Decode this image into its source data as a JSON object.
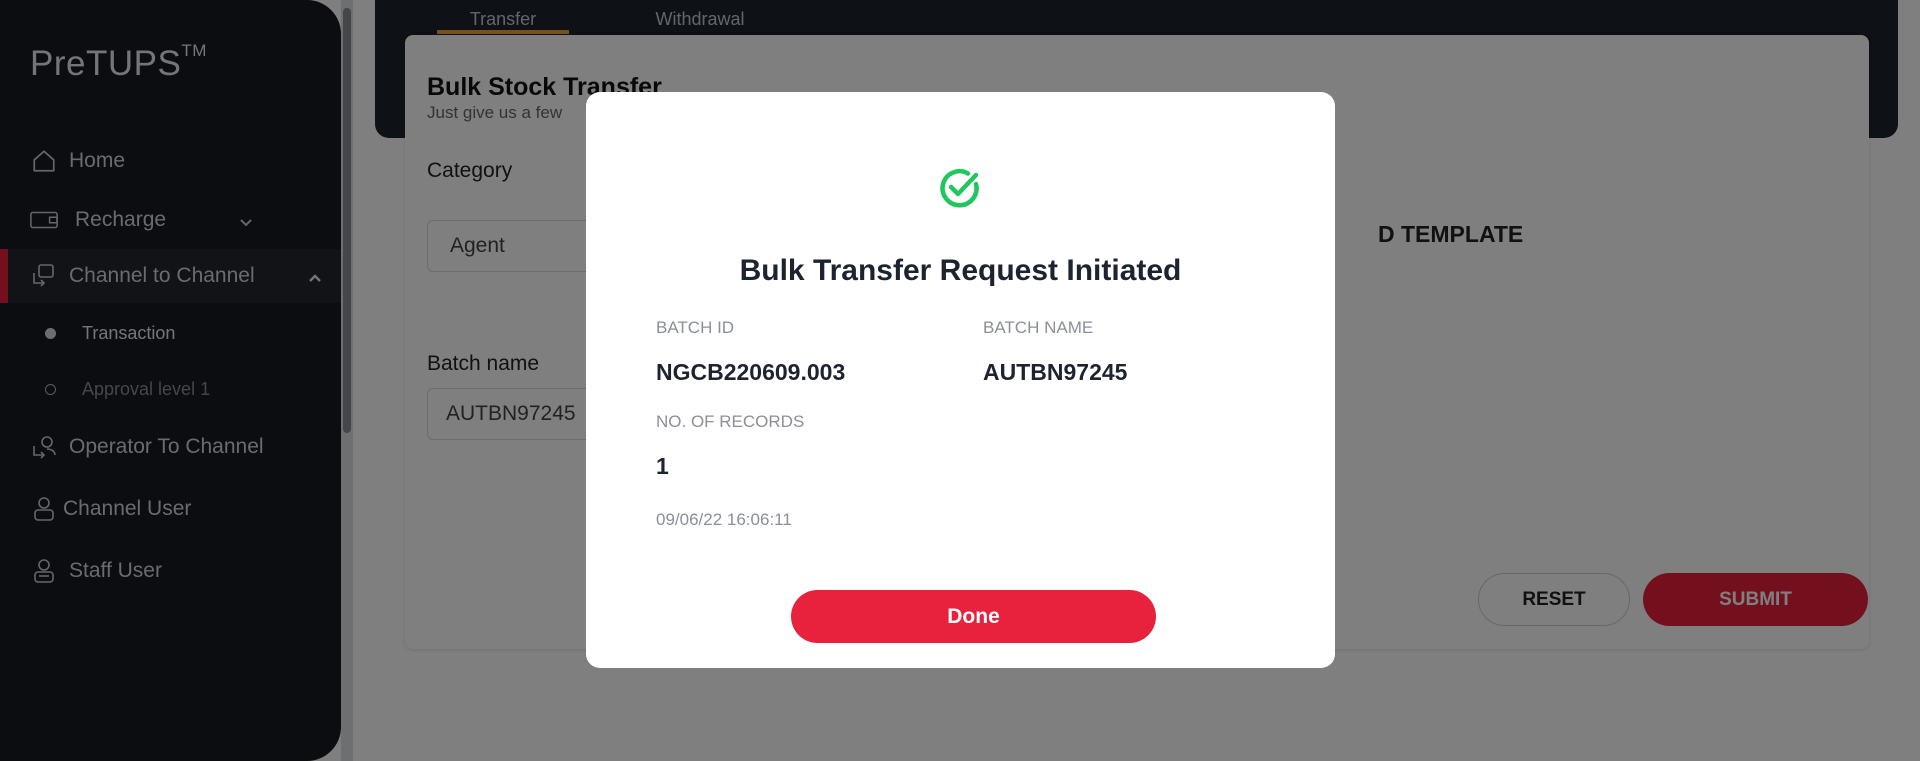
{
  "app": {
    "logo_text": "PreTUPS",
    "logo_tm": "TM"
  },
  "sidebar": {
    "items": [
      {
        "label": "Home",
        "icon": "home-icon"
      },
      {
        "label": "Recharge",
        "icon": "recharge-icon"
      },
      {
        "label": "Channel to Channel",
        "icon": "channel-icon"
      },
      {
        "label": "Operator To Channel",
        "icon": "operator-icon"
      },
      {
        "label": "Channel User",
        "icon": "user-icon"
      },
      {
        "label": "Staff User",
        "icon": "staff-icon"
      }
    ],
    "sub_items": [
      {
        "label": "Transaction"
      },
      {
        "label": "Approval level 1"
      }
    ]
  },
  "tabs": [
    {
      "label": "Transfer"
    },
    {
      "label": "Withdrawal"
    }
  ],
  "form": {
    "title": "Bulk Stock Transfer",
    "subtitle": "Just give us a few",
    "category_label": "Category",
    "category_value": "Agent",
    "batch_label": "Batch name",
    "batch_value": "AUTBN97245",
    "template_link": "D TEMPLATE",
    "reset_label": "RESET",
    "submit_label": "SUBMIT"
  },
  "modal": {
    "title": "Bulk Transfer Request Initiated",
    "batch_id_label": "BATCH ID",
    "batch_id_value": "NGCB220609.003",
    "batch_name_label": "BATCH NAME",
    "batch_name_value": "AUTBN97245",
    "records_label": "NO. OF RECORDS",
    "records_value": "1",
    "timestamp": "09/06/22 16:06:11",
    "done_label": "Done"
  },
  "colors": {
    "accent": "#e8213d",
    "success": "#22c55e",
    "sidebar_bg": "#161b22",
    "tab_underline": "#f2a13b"
  }
}
